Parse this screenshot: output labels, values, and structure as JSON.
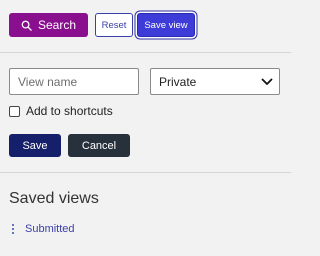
{
  "toolbar": {
    "search_label": "Search",
    "reset_label": "Reset",
    "save_view_label": "Save view",
    "search_color": "#8a0f8f",
    "save_view_color": "#3d3cd8"
  },
  "form": {
    "view_name_placeholder": "View name",
    "view_name_value": "",
    "privacy_selected": "Private",
    "shortcut_label": "Add to shortcuts",
    "shortcut_checked": false,
    "save_label": "Save",
    "cancel_label": "Cancel"
  },
  "saved_views": {
    "title": "Saved views",
    "items": [
      {
        "label": "Submitted"
      }
    ]
  },
  "icons": {
    "search": "search-icon",
    "dropdown": "chevron-down-icon",
    "menu": "kebab-menu-icon"
  }
}
